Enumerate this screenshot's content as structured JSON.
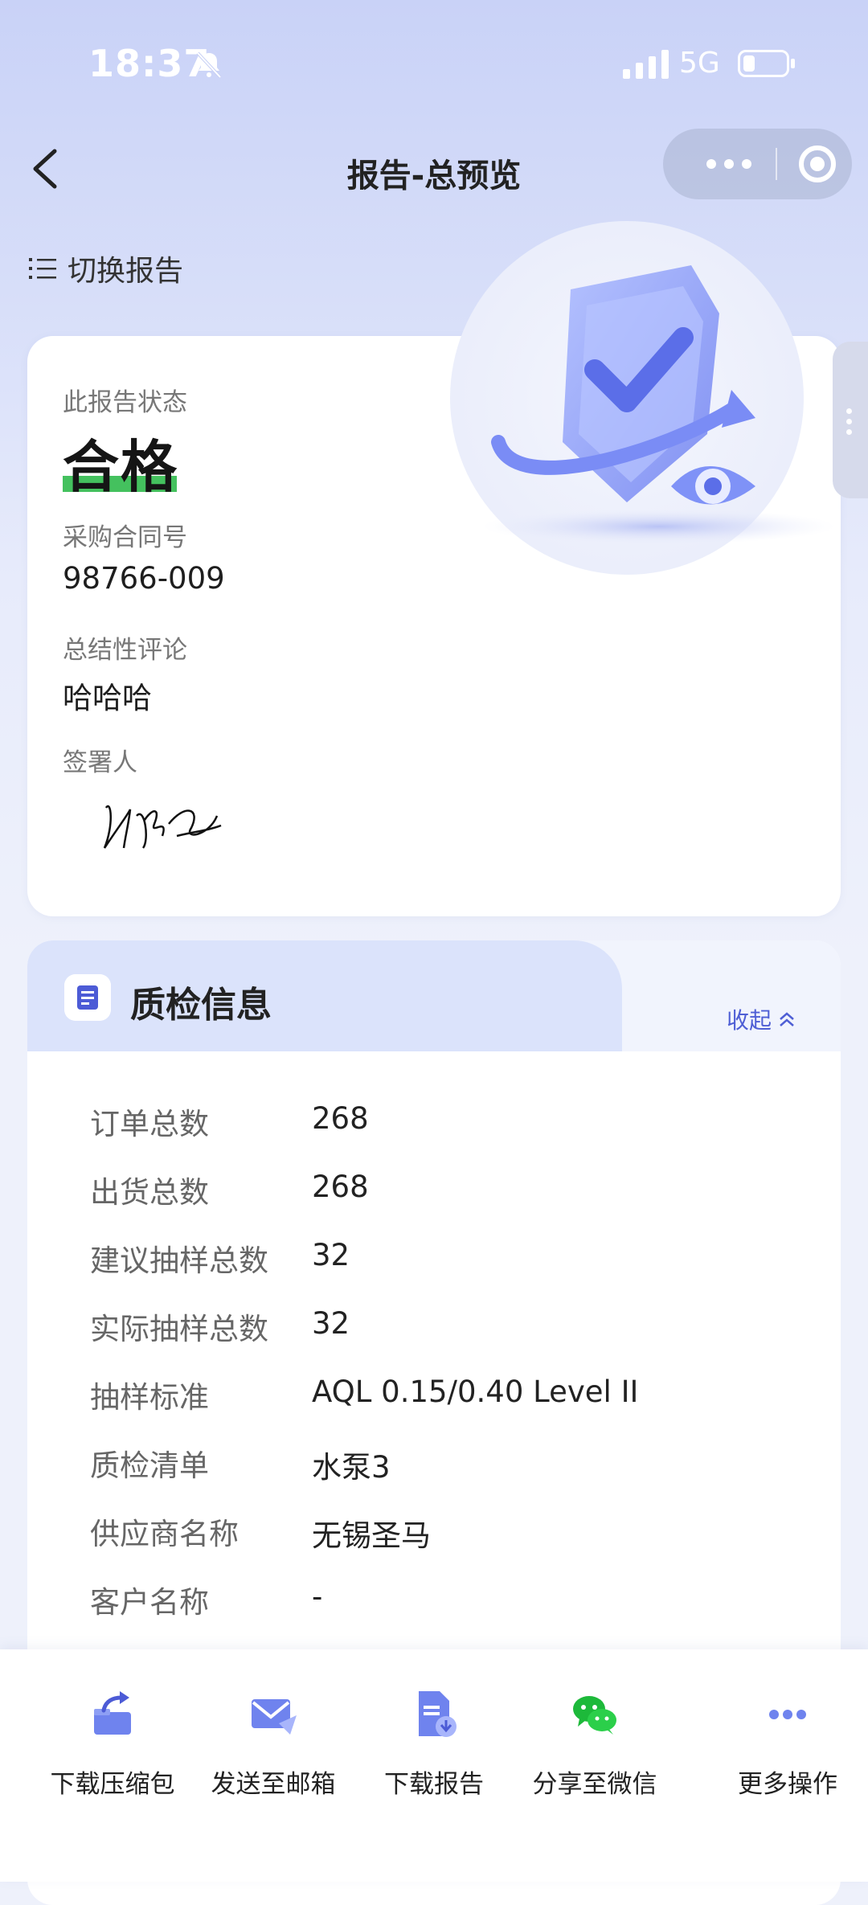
{
  "status_bar": {
    "time": "18:37",
    "network": "5G"
  },
  "nav": {
    "title": "报告-总预览"
  },
  "switch_report": {
    "label": "切换报告"
  },
  "summary": {
    "status_label": "此报告状态",
    "status_value": "合格",
    "contract_label": "采购合同号",
    "contract_value": "98766-009",
    "comment_label": "总结性评论",
    "comment_value": "哈哈哈",
    "signer_label": "签署人"
  },
  "qc": {
    "title": "质检信息",
    "collapse_label": "收起",
    "rows": [
      {
        "label": "订单总数",
        "value": "268"
      },
      {
        "label": "出货总数",
        "value": "268"
      },
      {
        "label": "建议抽样总数",
        "value": "32"
      },
      {
        "label": "实际抽样总数",
        "value": "32"
      },
      {
        "label": "抽样标准",
        "value": "AQL 0.15/0.40 Level II"
      },
      {
        "label": "质检清单",
        "value": "水泵3"
      },
      {
        "label": "供应商名称",
        "value": "无锡圣马"
      },
      {
        "label": "客户名称",
        "value": "-"
      }
    ]
  },
  "actions": [
    {
      "label": "下载压缩包",
      "icon": "download-package-icon"
    },
    {
      "label": "发送至邮箱",
      "icon": "send-mail-icon"
    },
    {
      "label": "下载报告",
      "icon": "download-report-icon"
    },
    {
      "label": "分享至微信",
      "icon": "wechat-icon"
    },
    {
      "label": "更多操作",
      "icon": "more-icon"
    }
  ],
  "colors": {
    "accent": "#4f5fd5",
    "pass_green": "#44c15e",
    "wechat_green": "#1db93a"
  }
}
